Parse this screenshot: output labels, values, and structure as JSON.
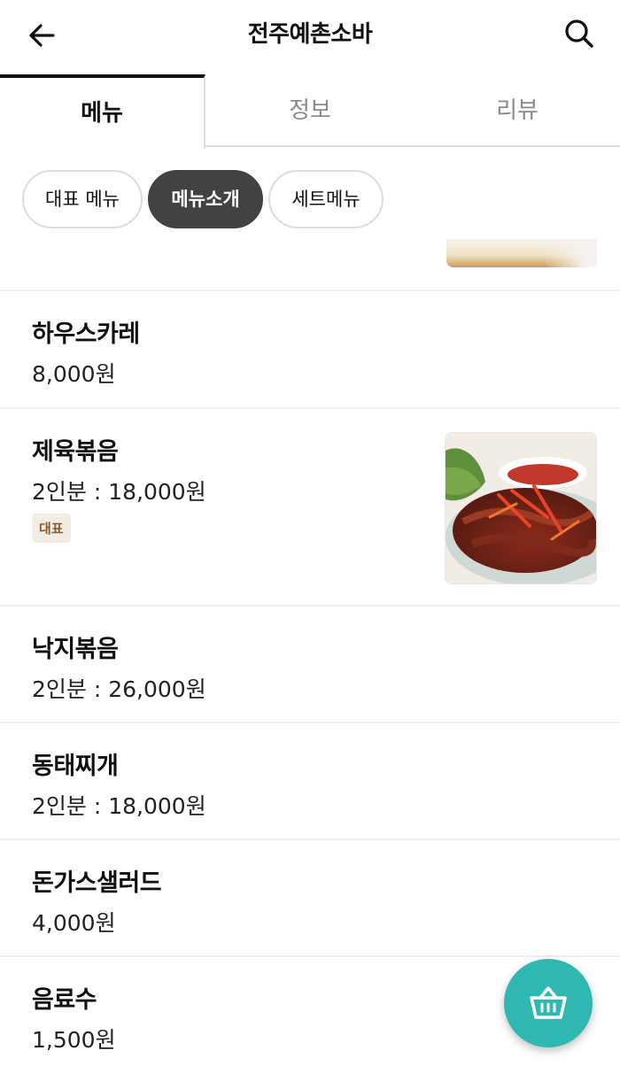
{
  "header": {
    "title": "전주예촌소바",
    "back_icon": "arrow-left-icon",
    "search_icon": "search-icon"
  },
  "tabs": [
    {
      "label": "메뉴",
      "active": true
    },
    {
      "label": "정보",
      "active": false
    },
    {
      "label": "리뷰",
      "active": false
    }
  ],
  "categories": [
    {
      "label": "대표 메뉴",
      "active": false
    },
    {
      "label": "메뉴소개",
      "active": true
    },
    {
      "label": "세트메뉴",
      "active": false
    }
  ],
  "menu": [
    {
      "name": "하우스카레",
      "price": "8,000원"
    },
    {
      "name": "제육볶음",
      "price": "2인분 : 18,000원",
      "badge": "대표",
      "has_image": true
    },
    {
      "name": "낙지볶음",
      "price": "2인분 : 26,000원"
    },
    {
      "name": "동태찌개",
      "price": "2인분 : 18,000원"
    },
    {
      "name": "돈가스샐러드",
      "price": "4,000원"
    },
    {
      "name": "음료수",
      "price": "1,500원"
    }
  ],
  "cart": {
    "icon": "basket-icon"
  },
  "colors": {
    "accent": "#2fb8b2",
    "chip_active": "#424242",
    "badge_bg": "#f3ece4",
    "badge_text": "#8b5a2b"
  }
}
